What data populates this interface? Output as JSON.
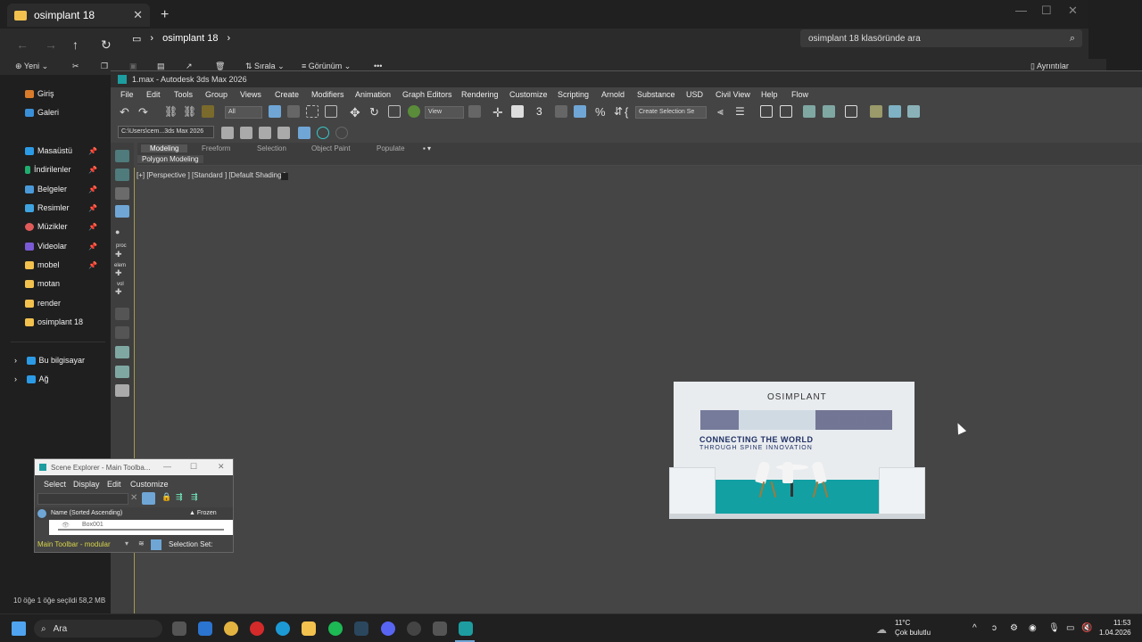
{
  "explorer": {
    "tab_title": "osimplant 18",
    "breadcrumb": "osimplant 18",
    "search_placeholder": "osimplant 18 klasöründe ara",
    "commands": {
      "new": "Yeni",
      "sort": "Sırala",
      "view": "Görünüm",
      "details": "Ayrıntılar"
    },
    "nav_items": [
      {
        "label": "Giriş"
      },
      {
        "label": "Galeri"
      },
      {
        "label": "Masaüstü"
      },
      {
        "label": "İndirilenler"
      },
      {
        "label": "Belgeler"
      },
      {
        "label": "Resimler"
      },
      {
        "label": "Müzikler"
      },
      {
        "label": "Videolar"
      },
      {
        "label": "mobel"
      },
      {
        "label": "motan"
      },
      {
        "label": "render"
      },
      {
        "label": "osimplant 18"
      },
      {
        "label": "Bu bilgisayar"
      },
      {
        "label": "Ağ"
      }
    ],
    "status": "10 öğe   1 öğe seçildi  58,2 MB"
  },
  "max": {
    "title": "1.max - Autodesk 3ds Max 2026",
    "menu": [
      "File",
      "Edit",
      "Tools",
      "Group",
      "Views",
      "Create",
      "Modifiers",
      "Animation",
      "Graph Editors",
      "Rendering",
      "Customize",
      "Scripting",
      "Arnold",
      "Substance",
      "USD",
      "Civil View",
      "Help",
      "Flow"
    ],
    "filter_dropdown": "All",
    "view_dropdown": "View",
    "selection_set": "Create Selection Se",
    "project_path": "C:\\Users\\cem...3ds Max 2026",
    "ribbon_tabs": [
      "Modeling",
      "Freeform",
      "Selection",
      "Object Paint",
      "Populate"
    ],
    "ribbon_sub": "Polygon Modeling",
    "viewport_label": "[+] [Perspective ] [Standard ] [Default Shading ]",
    "side_labels": {
      "proc": "proc",
      "elem": "elem",
      "vol": "vol"
    }
  },
  "booth": {
    "brand": "OSIMPLANT",
    "line1": "CONNECTING THE WORLD",
    "line2": "THROUGH SPINE INNOVATION"
  },
  "scene_explorer": {
    "title": "Scene Explorer - Main Toolba...",
    "menu": [
      "Select",
      "Display",
      "Edit",
      "Customize"
    ],
    "col_name": "Name (Sorted Ascending)",
    "col_frozen": "▲ Frozen",
    "row": "Box001",
    "bottom_left": "Main Toolbar - modular",
    "selection_set": "Selection Set:"
  },
  "taskbar": {
    "search": "Ara",
    "weather_temp": "11°C",
    "weather_desc": "Çok bulutlu",
    "time": "11:53",
    "date": "1.04.2026"
  },
  "colors": {
    "teal": "#12a0a3",
    "accent_yellow": "#d6d34a",
    "folder": "#f2c14e"
  }
}
